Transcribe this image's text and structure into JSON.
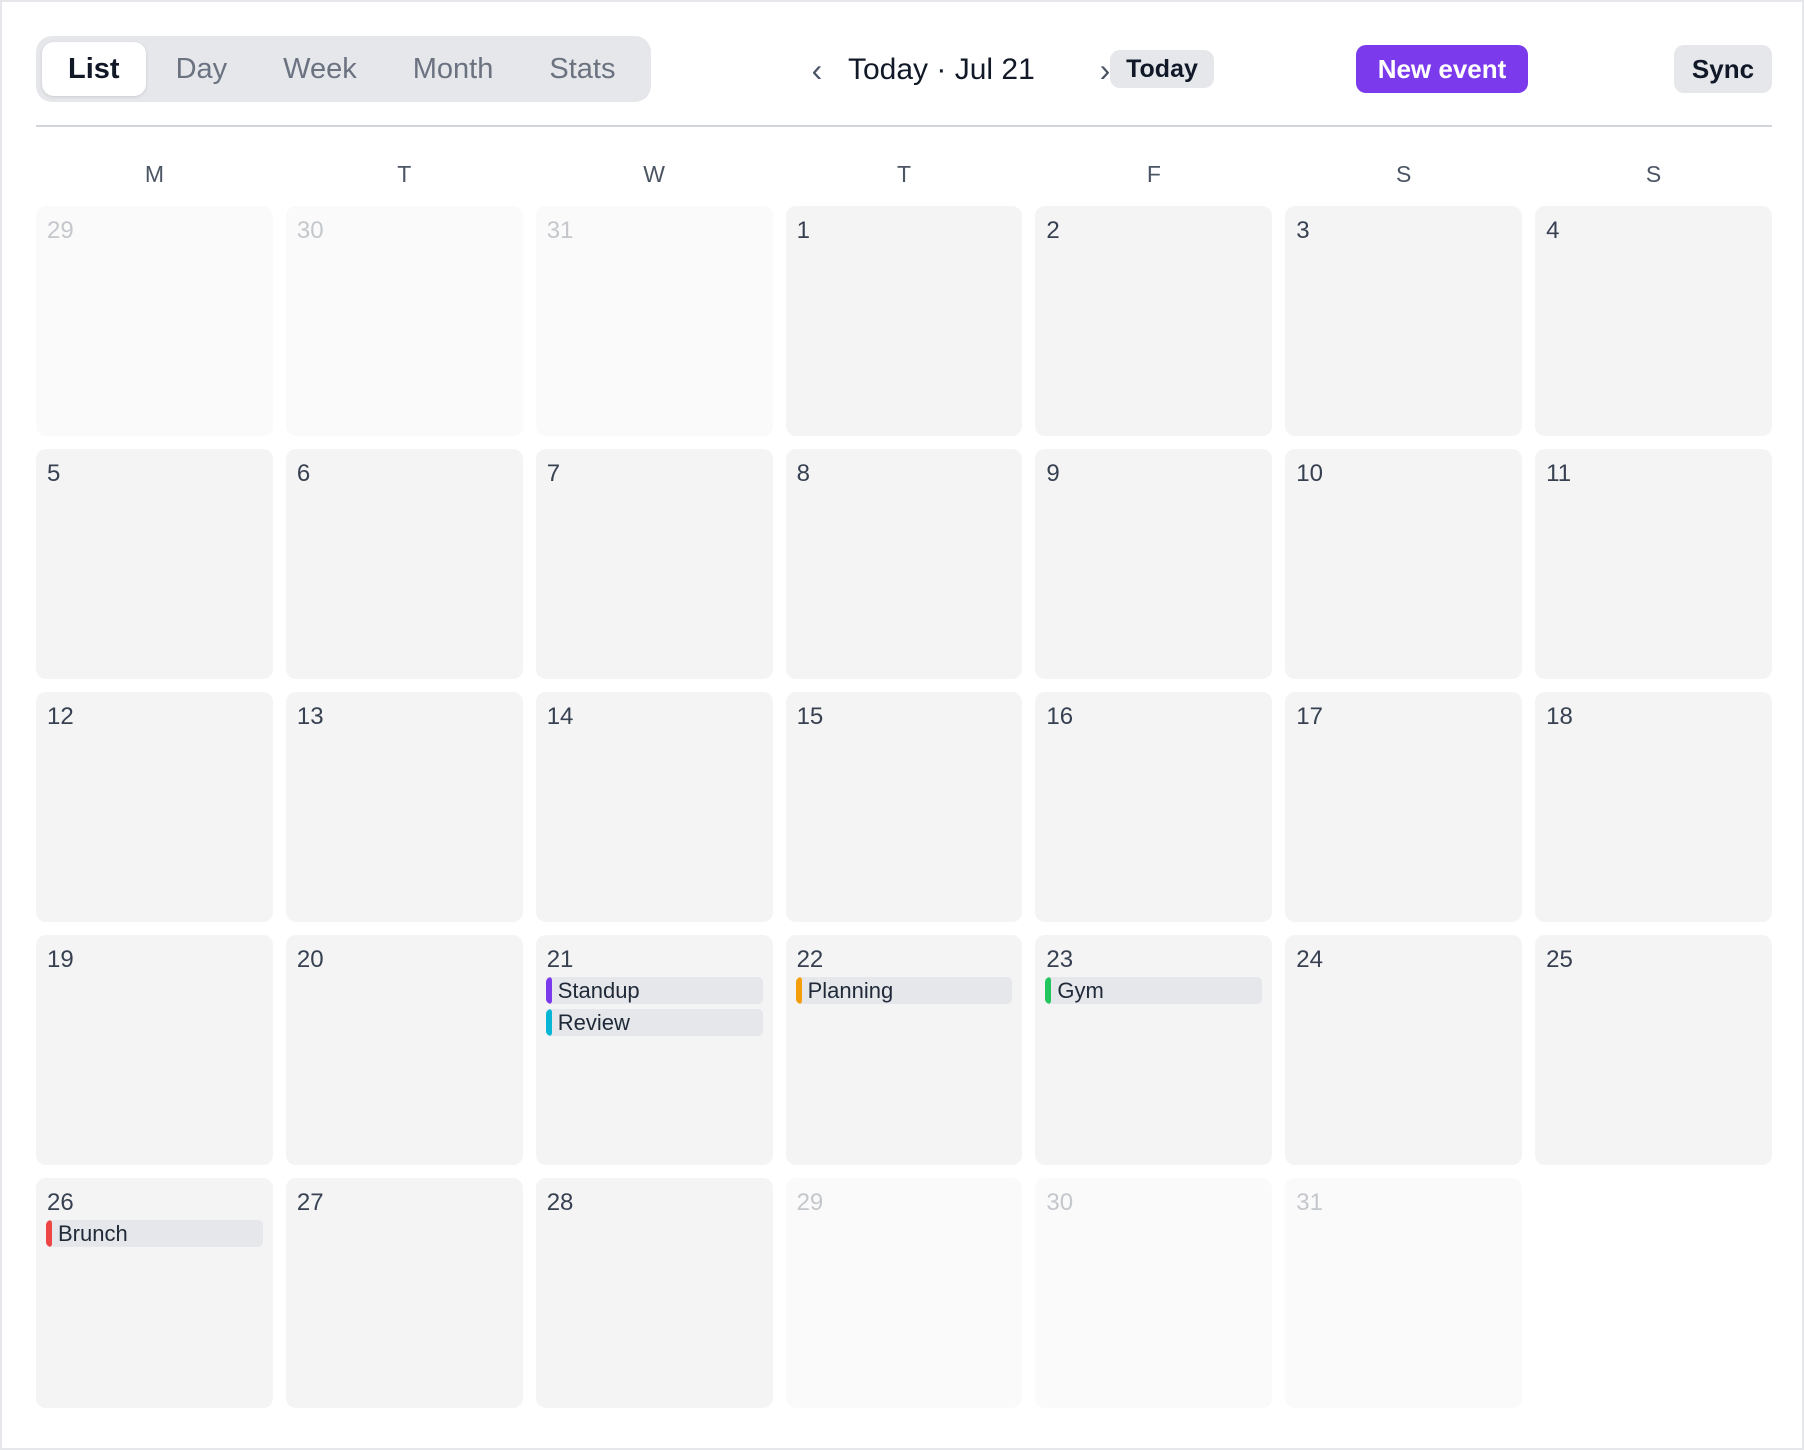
{
  "toolbar": {
    "views": [
      {
        "label": "List",
        "active": true
      },
      {
        "label": "Day",
        "active": false
      },
      {
        "label": "Week",
        "active": false
      },
      {
        "label": "Month",
        "active": false
      },
      {
        "label": "Stats",
        "active": false
      }
    ],
    "prev_icon": "‹",
    "title": "Today · Jul 21",
    "next_icon": "›",
    "today_label": "Today",
    "new_event_label": "New event",
    "sync_label": "Sync"
  },
  "colors": {
    "accent": "#7c3aed"
  },
  "weekdays": [
    "M",
    "T",
    "W",
    "T",
    "F",
    "S",
    "S"
  ],
  "weeks": [
    [
      {
        "day": "29",
        "outside": true,
        "events": []
      },
      {
        "day": "30",
        "outside": true,
        "events": []
      },
      {
        "day": "31",
        "outside": true,
        "events": []
      },
      {
        "day": "1",
        "outside": false,
        "events": []
      },
      {
        "day": "2",
        "outside": false,
        "events": []
      },
      {
        "day": "3",
        "outside": false,
        "events": []
      },
      {
        "day": "4",
        "outside": false,
        "events": []
      }
    ],
    [
      {
        "day": "5",
        "outside": false,
        "events": []
      },
      {
        "day": "6",
        "outside": false,
        "events": []
      },
      {
        "day": "7",
        "outside": false,
        "events": []
      },
      {
        "day": "8",
        "outside": false,
        "events": []
      },
      {
        "day": "9",
        "outside": false,
        "events": []
      },
      {
        "day": "10",
        "outside": false,
        "events": []
      },
      {
        "day": "11",
        "outside": false,
        "events": []
      }
    ],
    [
      {
        "day": "12",
        "outside": false,
        "events": []
      },
      {
        "day": "13",
        "outside": false,
        "events": []
      },
      {
        "day": "14",
        "outside": false,
        "events": []
      },
      {
        "day": "15",
        "outside": false,
        "events": []
      },
      {
        "day": "16",
        "outside": false,
        "events": []
      },
      {
        "day": "17",
        "outside": false,
        "events": []
      },
      {
        "day": "18",
        "outside": false,
        "events": []
      }
    ],
    [
      {
        "day": "19",
        "outside": false,
        "events": []
      },
      {
        "day": "20",
        "outside": false,
        "events": []
      },
      {
        "day": "21",
        "outside": false,
        "events": [
          {
            "title": "Standup",
            "color": "#7c3aed"
          },
          {
            "title": "Review",
            "color": "#06b6d4"
          }
        ]
      },
      {
        "day": "22",
        "outside": false,
        "events": [
          {
            "title": "Planning",
            "color": "#f59e0b"
          }
        ]
      },
      {
        "day": "23",
        "outside": false,
        "events": [
          {
            "title": "Gym",
            "color": "#22c55e"
          }
        ]
      },
      {
        "day": "24",
        "outside": false,
        "events": []
      },
      {
        "day": "25",
        "outside": false,
        "events": []
      }
    ],
    [
      {
        "day": "26",
        "outside": false,
        "events": [
          {
            "title": "Brunch",
            "color": "#ef4444"
          }
        ]
      },
      {
        "day": "27",
        "outside": false,
        "events": []
      },
      {
        "day": "28",
        "outside": false,
        "events": []
      },
      {
        "day": "29",
        "outside": true,
        "events": []
      },
      {
        "day": "30",
        "outside": true,
        "events": []
      },
      {
        "day": "31",
        "outside": true,
        "events": []
      },
      {
        "day": null,
        "outside": true,
        "events": []
      }
    ]
  ]
}
